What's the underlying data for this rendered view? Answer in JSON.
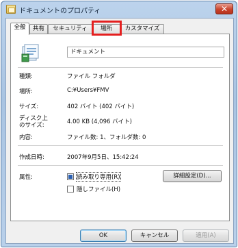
{
  "window": {
    "title": "ドキュメントのプロパティ",
    "close_label": "✕"
  },
  "tabs": [
    {
      "label": "全般",
      "active": true
    },
    {
      "label": "共有",
      "active": false
    },
    {
      "label": "セキュリティ",
      "active": false
    },
    {
      "label": "場所",
      "active": false,
      "highlighted": true
    },
    {
      "label": "カスタマイズ",
      "active": false
    }
  ],
  "general": {
    "name_value": "ドキュメント",
    "properties": {
      "type": {
        "label": "種類:",
        "value": "ファイル フォルダ"
      },
      "location": {
        "label": "場所:",
        "value": "C:¥Users¥FMV"
      },
      "size": {
        "label": "サイズ:",
        "value": "402 バイト (402 バイト)"
      },
      "size_on_disk": {
        "label_line1": "ディスク上",
        "label_line2": "のサイズ:",
        "value": "4.00 KB (4,096 バイト)"
      },
      "contents": {
        "label": "内容:",
        "value": "ファイル数: 1、フォルダ数: 0"
      },
      "created": {
        "label": "作成日時:",
        "value": "2007年9月5日、15:42:24"
      }
    },
    "attributes": {
      "label": "属性:",
      "readonly_label": "読み取り専用(R)",
      "readonly_checked": true,
      "hidden_label": "隠しファイル(H)",
      "hidden_checked": false,
      "advanced_button": "詳細設定(D)..."
    }
  },
  "footer": {
    "ok": "OK",
    "cancel": "キャンセル",
    "apply": "適用(A)"
  },
  "icons": {
    "title": "folder-properties-icon",
    "item": "documents-folder-icon"
  }
}
